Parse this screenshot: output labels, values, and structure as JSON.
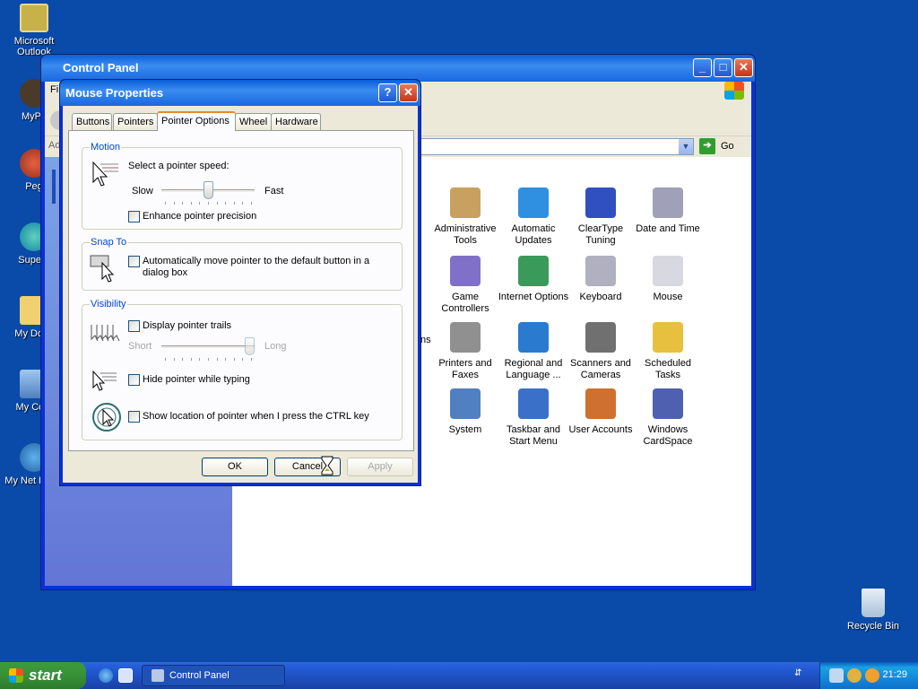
{
  "desktop": {
    "icons": [
      {
        "label": "Microsoft Outlook",
        "icon": "outlook-icon"
      },
      {
        "label": "MyPa",
        "icon": "mypa-icon"
      },
      {
        "label": "Peg",
        "icon": "peg-icon"
      },
      {
        "label": "Supern",
        "icon": "supern-icon"
      },
      {
        "label": "My Docu",
        "icon": "my-documents-icon"
      },
      {
        "label": "My Com",
        "icon": "my-computer-icon"
      },
      {
        "label": "My Net Place",
        "icon": "my-network-places-icon"
      },
      {
        "label": "Recycle Bin",
        "icon": "recycle-bin-icon"
      }
    ]
  },
  "control_panel": {
    "title": "Control Panel",
    "menu_fragment": "Fi",
    "address_fragment": "Ad",
    "go_label": "Go",
    "partial_item": "ns",
    "items": [
      {
        "label": "Administrative Tools",
        "icon": "administrative-tools-icon",
        "color": "#c8a060"
      },
      {
        "label": "Automatic Updates",
        "icon": "automatic-updates-icon",
        "color": "#2f8fe0"
      },
      {
        "label": "ClearType Tuning",
        "icon": "cleartype-tuning-icon",
        "color": "#3050c0"
      },
      {
        "label": "Date and Time",
        "icon": "date-and-time-icon",
        "color": "#a0a0b8"
      },
      {
        "label": "Game Controllers",
        "icon": "game-controllers-icon",
        "color": "#8070c8"
      },
      {
        "label": "Internet Options",
        "icon": "internet-options-icon",
        "color": "#3a9a5a"
      },
      {
        "label": "Keyboard",
        "icon": "keyboard-icon",
        "color": "#b0b0c0"
      },
      {
        "label": "Mouse",
        "icon": "mouse-icon",
        "color": "#d8d8e0"
      },
      {
        "label": "Printers and Faxes",
        "icon": "printers-and-faxes-icon",
        "color": "#909090"
      },
      {
        "label": "Regional and Language ...",
        "icon": "regional-language-icon",
        "color": "#2a7ad0"
      },
      {
        "label": "Scanners and Cameras",
        "icon": "scanners-cameras-icon",
        "color": "#707070"
      },
      {
        "label": "Scheduled Tasks",
        "icon": "scheduled-tasks-icon",
        "color": "#e8c040"
      },
      {
        "label": "System",
        "icon": "system-icon",
        "color": "#5080c0"
      },
      {
        "label": "Taskbar and Start Menu",
        "icon": "taskbar-start-menu-icon",
        "color": "#3a70c8"
      },
      {
        "label": "User Accounts",
        "icon": "user-accounts-icon",
        "color": "#d07030"
      },
      {
        "label": "Windows CardSpace",
        "icon": "windows-cardspace-icon",
        "color": "#5060b0"
      }
    ]
  },
  "mouse_properties": {
    "title": "Mouse Properties",
    "help_label": "?",
    "tabs": [
      "Buttons",
      "Pointers",
      "Pointer Options",
      "Wheel",
      "Hardware"
    ],
    "active_tab": "Pointer Options",
    "motion": {
      "group_label": "Motion",
      "speed_label": "Select a pointer speed:",
      "slow_label": "Slow",
      "fast_label": "Fast",
      "speed_value": 0.5,
      "precision_label": "Enhance pointer precision",
      "precision_checked": false
    },
    "snap_to": {
      "group_label": "Snap To",
      "label_line1": "Automatically move pointer to the default button in a",
      "label_line2": "dialog box",
      "checked": false
    },
    "visibility": {
      "group_label": "Visibility",
      "trails_label": "Display pointer trails",
      "trails_checked": false,
      "short_label": "Short",
      "long_label": "Long",
      "trail_value": 1.0,
      "hide_label": "Hide pointer while typing",
      "hide_checked": false,
      "ctrl_label": "Show location of pointer when I press the CTRL key",
      "ctrl_checked": false
    },
    "buttons": {
      "ok": "OK",
      "cancel": "Cancel",
      "apply": "Apply"
    }
  },
  "taskbar": {
    "start_label": "start",
    "task_label": "Control Panel",
    "clock": "21:29"
  }
}
